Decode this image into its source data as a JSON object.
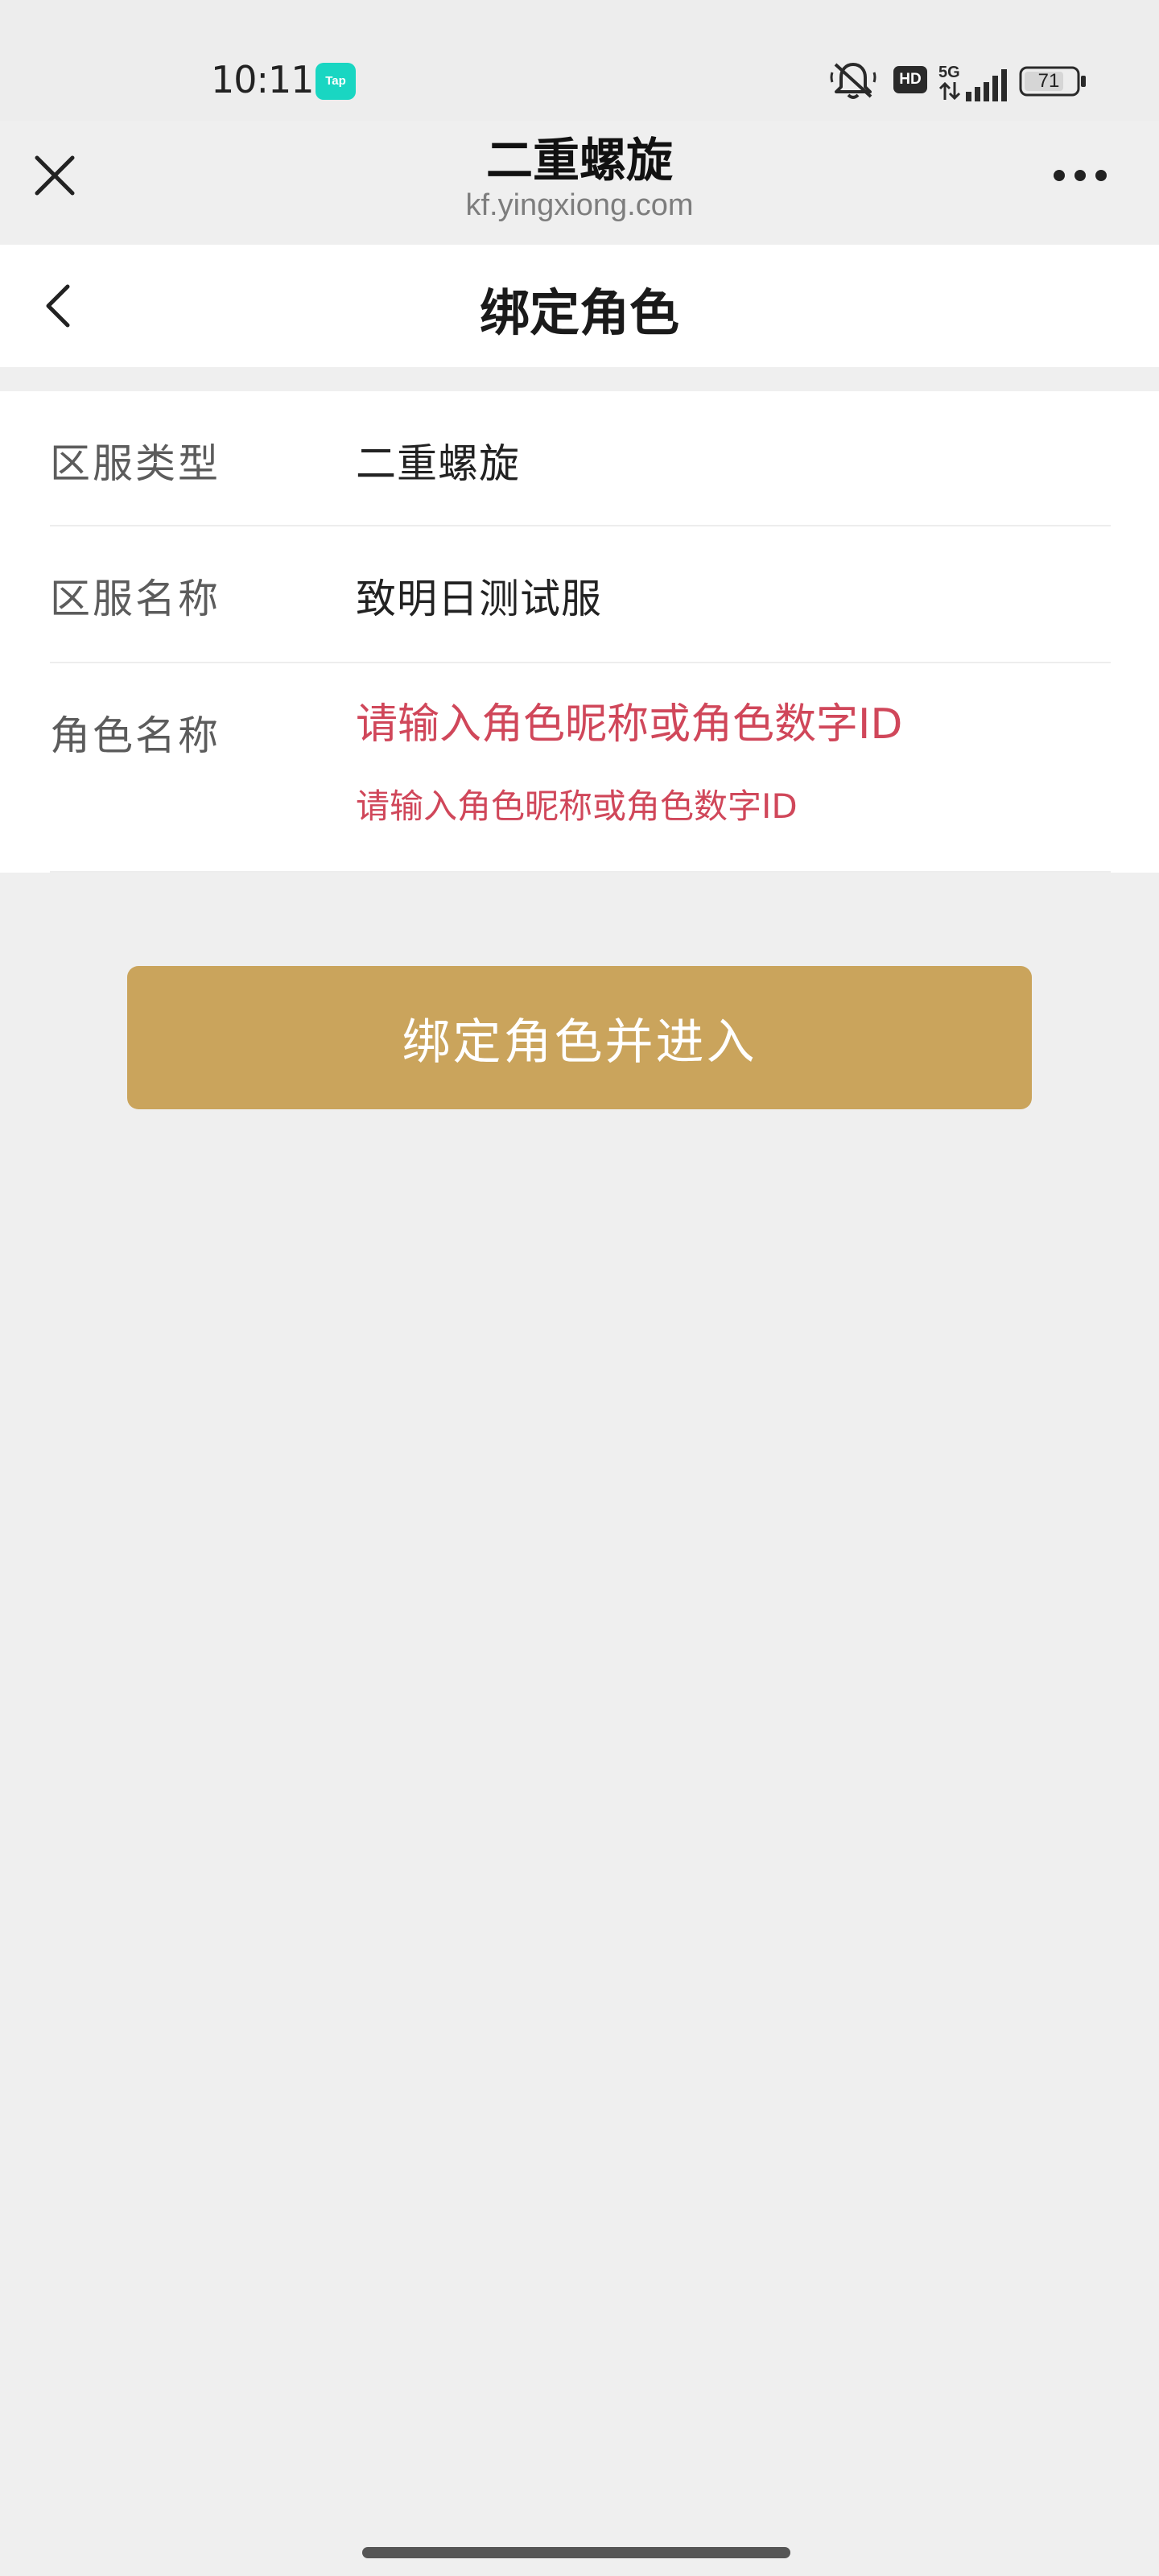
{
  "status_bar": {
    "time": "10:11",
    "app_badge": "Tap",
    "hd_label": "HD",
    "network_label": "5G",
    "battery": "71",
    "icons": [
      "bell-off-icon",
      "hd-icon",
      "signal-5g-icon",
      "battery-icon"
    ]
  },
  "webview": {
    "title": "二重螺旋",
    "url": "kf.yingxiong.com",
    "close_icon": "close-icon",
    "more_icon": "more-dots-icon"
  },
  "page": {
    "title": "绑定角色",
    "back_icon": "chevron-left-icon"
  },
  "form": {
    "server_type": {
      "label": "区服类型",
      "value": "二重螺旋"
    },
    "server_name": {
      "label": "区服名称",
      "value": "致明日测试服"
    },
    "role_name": {
      "label": "角色名称",
      "placeholder": "请输入角色昵称或角色数字ID",
      "value": "",
      "hint": "请输入角色昵称或角色数字ID"
    }
  },
  "actions": {
    "submit_label": "绑定角色并进入"
  },
  "colors": {
    "accent": "#caa45c",
    "error": "#d0475a",
    "background": "#efefef"
  }
}
